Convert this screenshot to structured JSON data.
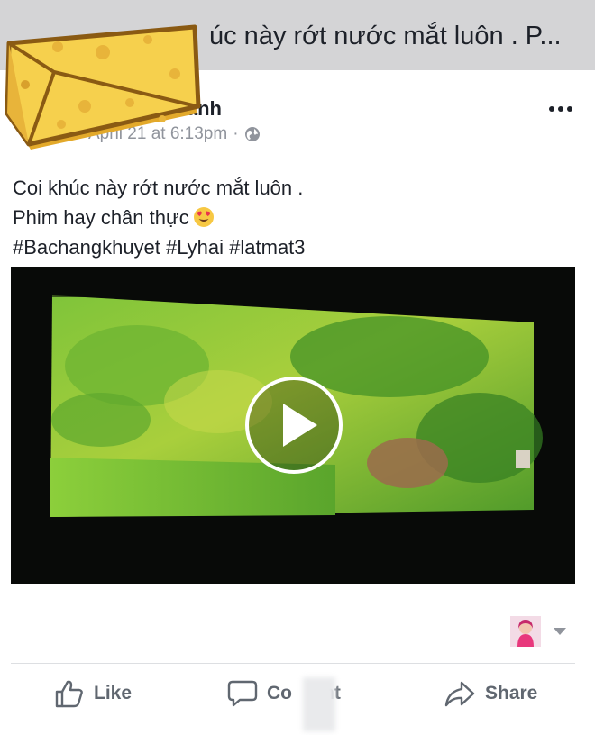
{
  "header": {
    "title": "úc này rớt nước mắt luôn . P..."
  },
  "post": {
    "author": "Thanh",
    "timestamp": "April 21 at 6:13pm",
    "separator": "·",
    "privacy_icon": "globe-icon",
    "more_icon": "more-options-icon",
    "text_lines": [
      "Coi khúc này rớt nước mắt luôn .",
      "Phim hay chân thực",
      "#Bachangkhuyet #Lyhai #latmat3"
    ],
    "emoji": "heart-eyes-emoji"
  },
  "video": {
    "play_icon": "play-icon"
  },
  "reactions": {
    "avatar": "reactor-avatar",
    "dropdown_icon": "caret-down-icon"
  },
  "actions": {
    "like": "Like",
    "comment_left": "Co",
    "comment_right": "nt",
    "share": "Share"
  },
  "colors": {
    "header_bg": "#d4d4d6",
    "text": "#1d2129",
    "meta": "#90949c",
    "action_text": "#606770",
    "cheese": "#f6d04d"
  }
}
